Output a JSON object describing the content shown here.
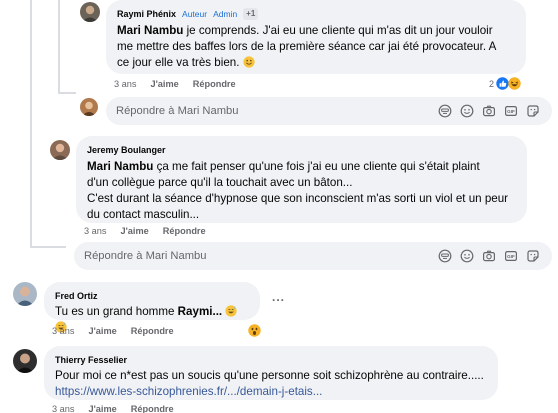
{
  "comments": [
    {
      "author": "Raymi Phénix",
      "badge_author": "Auteur",
      "badge_admin": "Admin",
      "badge_more": "+1",
      "mention": "Mari Nambu",
      "text_line1_rest": " je comprends. J'ai eu une cliente qui m'as dit un jour vouloir",
      "text_line2": "me mettre des baffes lors de la première séance car jai été provocateur. A",
      "text_line3": "ce jour elle va très bien.",
      "time": "3 ans",
      "like": "J'aime",
      "reply": "Répondre",
      "reaction_count": "2"
    },
    {
      "author": "Jeremy Boulanger",
      "mention": "Mari Nambu",
      "text_line1_rest": " ça me fait penser qu'une fois j'ai eu une cliente qui s'était plaint",
      "text_line2": "d'un collègue parce qu'il la touchait avec un bâton...",
      "text_line3": "C'est durant la séance d'hypnose que son inconscient m'as sorti un viol et un peur",
      "text_line4": "du contact masculin...",
      "time": "3 ans",
      "like": "J'aime",
      "reply": "Répondre"
    },
    {
      "author": "Fred Ortiz",
      "text_start": "Tu es un grand homme ",
      "text_bold": "Raymi...",
      "time": "3 ans",
      "like": "J'aime",
      "reply": "Répondre",
      "more": "..."
    },
    {
      "author": "Thierry Fesselier",
      "text_line1": "Pour moi ce n*est pas un soucis qu'une personne soit schizophrène au contraire.....",
      "link": "https://www.les-schizophrenies.fr/.../demain-j-etais...",
      "time": "3 ans",
      "like": "J'aime",
      "reply": "Répondre"
    }
  ],
  "reply_boxes": [
    {
      "placeholder": "Répondre à Mari Nambu"
    },
    {
      "placeholder": "Répondre à Mari Nambu"
    }
  ],
  "icons": {
    "composer": [
      "avatar-sticker-icon",
      "emoji-icon",
      "camera-icon",
      "gif-icon",
      "sticker-icon"
    ],
    "reactions": [
      "like-icon",
      "love-icon",
      "haha-icon",
      "wow-icon"
    ]
  },
  "colors": {
    "bubble": "#f0f2f5",
    "text": "#050505",
    "muted": "#65676b",
    "badge": "#1b6fd6",
    "link": "#385898",
    "thread_line": "#d9dce1"
  }
}
